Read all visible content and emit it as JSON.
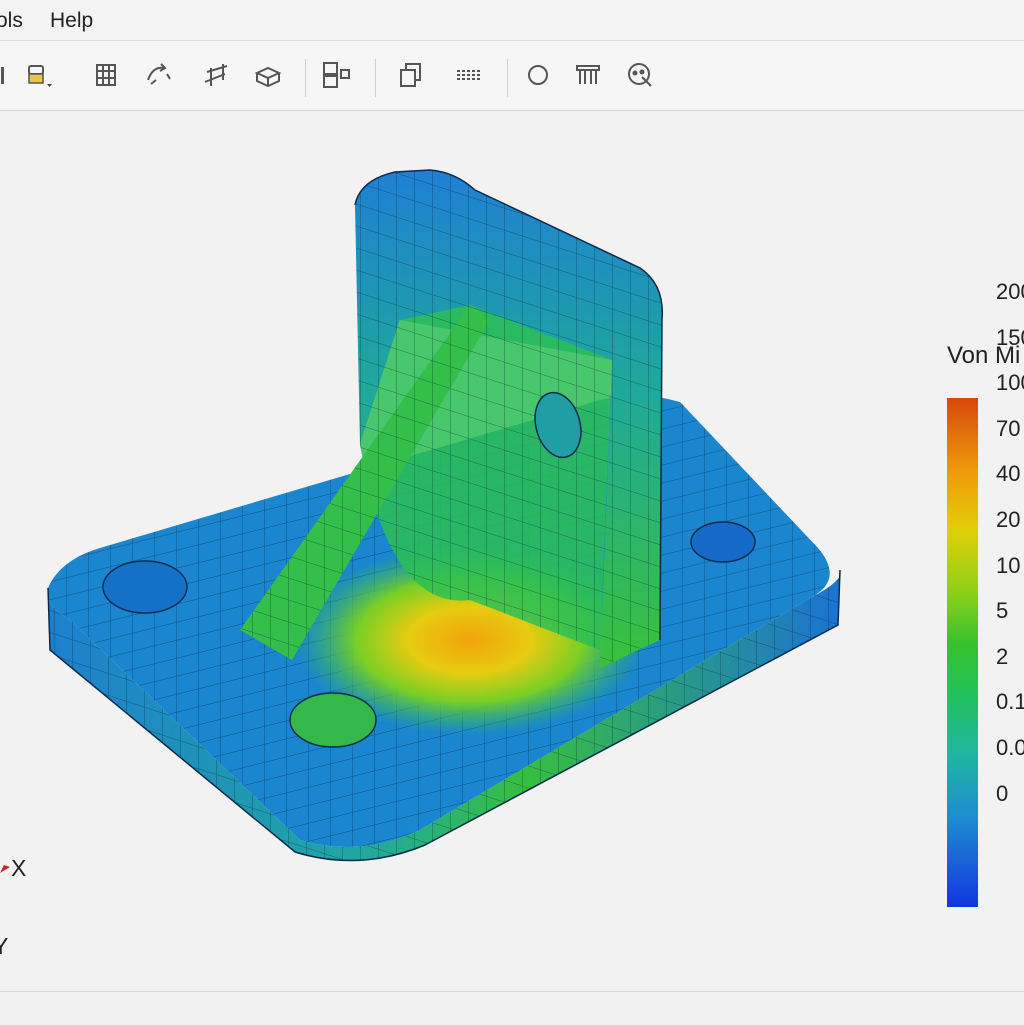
{
  "menu": {
    "items": [
      "ols",
      "Help"
    ]
  },
  "toolbar": {
    "tools": [
      "open-icon",
      "material-dropdown-icon",
      "mesh-grid-icon",
      "load-icon",
      "section-cut-icon",
      "solid-view-icon",
      "layout-icon",
      "copy-view-icon",
      "lines-icon",
      "sphere-icon",
      "fixture-icon",
      "probe-icon"
    ]
  },
  "legend": {
    "title": "Von Mi",
    "labels": [
      "200",
      "150",
      "100",
      "70",
      "40",
      "20",
      "10",
      "5",
      "2",
      "0.1",
      "0.0",
      "0"
    ],
    "colors": [
      "#1036e0",
      "#1d8fcf",
      "#22c25a",
      "#e1cf08",
      "#d8480c"
    ]
  },
  "axes": {
    "x_label": "X",
    "y_label": "Y"
  }
}
